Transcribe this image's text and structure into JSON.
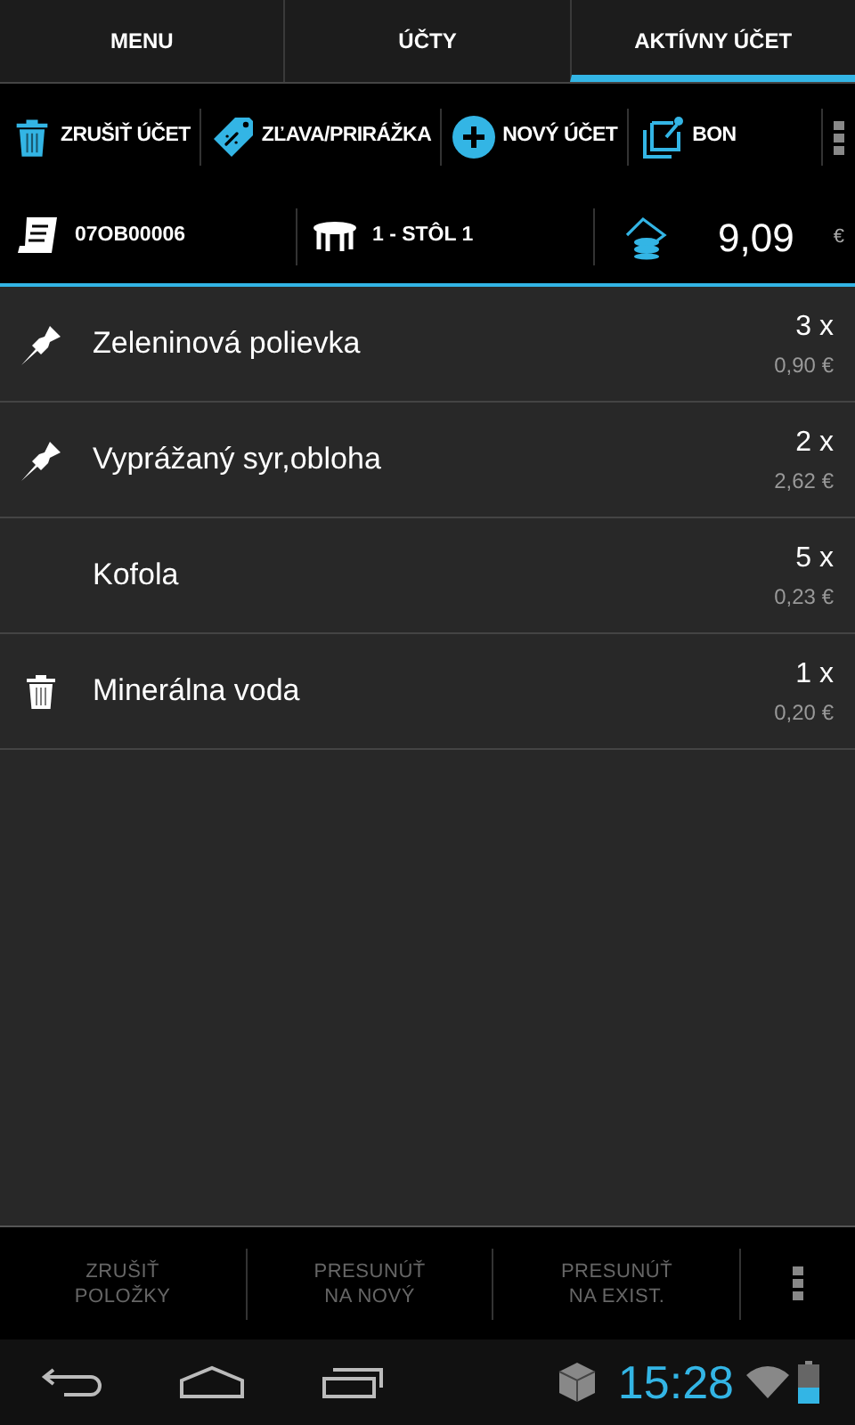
{
  "tabs": [
    {
      "label": "MENU",
      "selected": false
    },
    {
      "label": "ÚČTY",
      "selected": false
    },
    {
      "label": "AKTÍVNY ÚČET",
      "selected": true
    }
  ],
  "actions": [
    {
      "kind": "trash",
      "label": "ZRUŠIŤ ÚČET"
    },
    {
      "kind": "tag",
      "label": "ZĽAVA/PRIRÁŽKA"
    },
    {
      "kind": "plus",
      "label": "NOVÝ ÚČET"
    },
    {
      "kind": "bon",
      "label": "BON"
    }
  ],
  "info": {
    "bill_number": "07OB00006",
    "table": "1 - STÔL 1",
    "total": "9,09",
    "currency": "€"
  },
  "items": [
    {
      "kind": "pinned",
      "name": "Zeleninová polievka",
      "quantity": "3 x",
      "price": "0,90 €"
    },
    {
      "kind": "pinned",
      "name": "Vyprážaný syr,obloha",
      "quantity": "2 x",
      "price": "2,62 €"
    },
    {
      "kind": "plain",
      "name": "Kofola",
      "quantity": "5 x",
      "price": "0,23 €"
    },
    {
      "kind": "deleted",
      "name": "Minerálna voda",
      "quantity": "1 x",
      "price": "0,20 €"
    }
  ],
  "bottom_actions": [
    {
      "lines": [
        "ZRUŠIŤ",
        "POLOŽKY"
      ],
      "disabled": true
    },
    {
      "lines": [
        "PRESUNÚŤ",
        "NA NOVÝ"
      ],
      "disabled": true
    },
    {
      "lines": [
        "PRESUNÚŤ",
        "NA EXIST."
      ],
      "disabled": true
    }
  ],
  "status_bar": {
    "time": "15:28"
  }
}
